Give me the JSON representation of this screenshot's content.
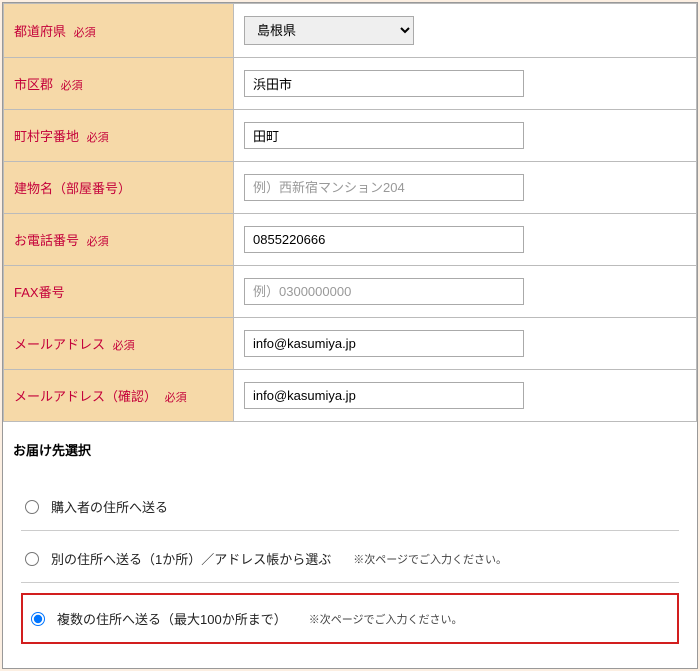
{
  "form": {
    "prefecture": {
      "label": "都道府県",
      "required": "必須",
      "value": "島根県"
    },
    "city": {
      "label": "市区郡",
      "required": "必須",
      "value": "浜田市"
    },
    "town": {
      "label": "町村字番地",
      "required": "必須",
      "value": "田町"
    },
    "building": {
      "label": "建物名（部屋番号）",
      "placeholder": "例）西新宿マンション204",
      "value": ""
    },
    "phone": {
      "label": "お電話番号",
      "required": "必須",
      "value": "0855220666"
    },
    "fax": {
      "label": "FAX番号",
      "placeholder": "例）0300000000",
      "value": ""
    },
    "email": {
      "label": "メールアドレス",
      "required": "必須",
      "value": "info@kasumiya.jp"
    },
    "email_confirm": {
      "label": "メールアドレス（確認）",
      "required": "必須",
      "value": "info@kasumiya.jp"
    }
  },
  "delivery": {
    "section_title": "お届け先選択",
    "options": [
      {
        "label": "購入者の住所へ送る",
        "hint": ""
      },
      {
        "label": "別の住所へ送る（1か所）／アドレス帳から選ぶ",
        "hint": "※次ページでご入力ください。"
      },
      {
        "label": "複数の住所へ送る（最大100か所まで）",
        "hint": "※次ページでご入力ください。"
      }
    ],
    "selected_index": 2
  }
}
